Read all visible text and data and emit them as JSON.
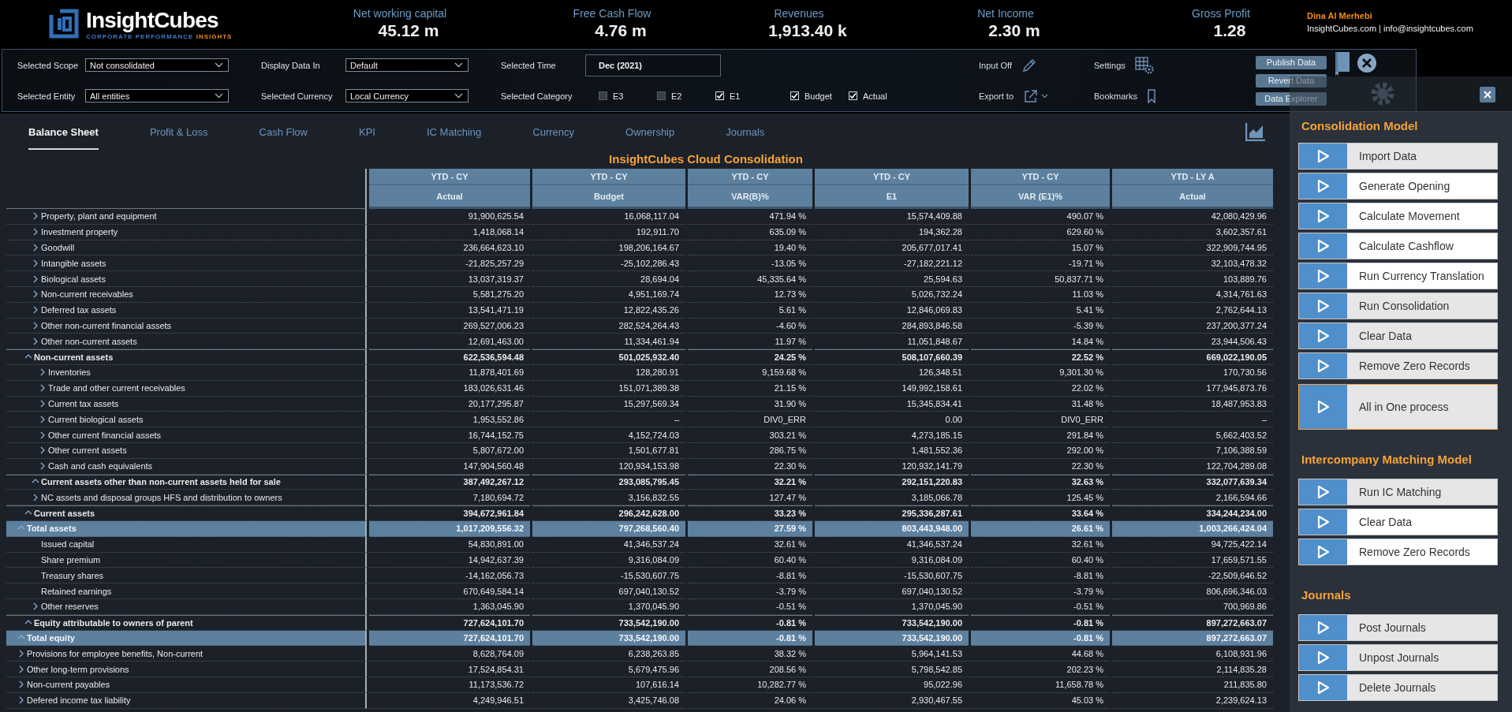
{
  "header": {
    "logo": {
      "wordmark": "InsightCubes",
      "tagline_lead": "CORPORATE PERFORMANCE",
      "tagline_accent": "INSIGHTS"
    },
    "kpis": [
      {
        "label": "Net working capital",
        "value": "45.12 m"
      },
      {
        "label": "Free Cash Flow",
        "value": "4.76 m"
      },
      {
        "label": "Revenues",
        "value": "1,913.40 k"
      },
      {
        "label": "Net Income",
        "value": "2.30 m"
      },
      {
        "label": "Gross Profit",
        "value": "1.28"
      }
    ],
    "user": {
      "name": "Dina Al Merhebi",
      "contact": "InsightCubes.com | info@insightcubes.com"
    }
  },
  "filters": {
    "scope": {
      "label": "Selected Scope",
      "value": "Not consolidated"
    },
    "entity": {
      "label": "Selected Entity",
      "value": "All entities"
    },
    "display": {
      "label": "Display Data In",
      "value": "Default"
    },
    "currency": {
      "label": "Selected Currency",
      "value": "Local Currency"
    },
    "time": {
      "label": "Selected Time",
      "value": "Dec (2021)"
    },
    "category": {
      "label": "Selected Category",
      "options": [
        {
          "label": "E3",
          "checked": false
        },
        {
          "label": "E2",
          "checked": false
        },
        {
          "label": "E1",
          "checked": true
        },
        {
          "label": "Budget",
          "checked": true
        },
        {
          "label": "Actual",
          "checked": true
        }
      ]
    },
    "actions": [
      {
        "label": "Input Off",
        "kind": "edit"
      },
      {
        "label": "Export to",
        "kind": "export"
      },
      {
        "label": "Settings",
        "kind": "settings"
      },
      {
        "label": "Bookmarks",
        "kind": "bookmarks"
      }
    ],
    "data_buttons": [
      "Publish Data",
      "Revert Data",
      "Data Explorer"
    ]
  },
  "tabs": [
    {
      "label": "Balance Sheet",
      "selected": true
    },
    {
      "label": "Profit & Loss",
      "selected": false
    },
    {
      "label": "Cash Flow",
      "selected": false
    },
    {
      "label": "KPI",
      "selected": false
    },
    {
      "label": "IC Matching",
      "selected": false
    },
    {
      "label": "Currency",
      "selected": false
    },
    {
      "label": "Ownership",
      "selected": false
    },
    {
      "label": "Journals",
      "selected": false
    }
  ],
  "report": {
    "title": "InsightCubes Cloud Consolidation",
    "columns": [
      {
        "period": "YTD - CY",
        "measure": "Actual"
      },
      {
        "period": "YTD - CY",
        "measure": "Budget"
      },
      {
        "period": "YTD - CY",
        "measure": "VAR(B)%"
      },
      {
        "period": "YTD - CY",
        "measure": "E1"
      },
      {
        "period": "YTD - CY",
        "measure": "VAR (E1)%"
      },
      {
        "period": "YTD - LY A",
        "measure": "Actual"
      }
    ],
    "rows": [
      {
        "label": "Total assets",
        "expanded": true,
        "kind": "total",
        "values": [
          "1,017,209,556.32",
          "797,268,560.40",
          "27.59 %",
          "803,443,948.00",
          "26.61 %",
          "1,003,266,424.04"
        ],
        "children": [
          {
            "label": "Non-current assets",
            "expanded": true,
            "kind": "subtotal",
            "values": [
              "622,536,594.48",
              "501,025,932.40",
              "24.25 %",
              "508,107,660.39",
              "22.52 %",
              "669,022,190.05"
            ],
            "children": [
              {
                "label": "Property, plant and equipment",
                "expanded": false,
                "kind": "item",
                "values": [
                  "91,900,625.54",
                  "16,068,117.04",
                  "471.94 %",
                  "15,574,409.88",
                  "490.07 %",
                  "42,080,429.96"
                ]
              },
              {
                "label": "Investment property",
                "expanded": false,
                "kind": "item",
                "values": [
                  "1,418,068.14",
                  "192,911.70",
                  "635.09 %",
                  "194,362.28",
                  "629.60 %",
                  "3,602,357.61"
                ]
              },
              {
                "label": "Goodwill",
                "expanded": false,
                "kind": "item",
                "values": [
                  "236,664,623.10",
                  "198,206,164.67",
                  "19.40 %",
                  "205,677,017.41",
                  "15.07 %",
                  "322,909,744.95"
                ]
              },
              {
                "label": "Intangible assets",
                "expanded": false,
                "kind": "item",
                "values": [
                  "-21,825,257.29",
                  "-25,102,286.43",
                  "-13.05 %",
                  "-27,182,221.12",
                  "-19.71 %",
                  "32,103,478.32"
                ]
              },
              {
                "label": "Biological assets",
                "expanded": false,
                "kind": "item",
                "values": [
                  "13,037,319.37",
                  "28,694.04",
                  "45,335.64 %",
                  "25,594.63",
                  "50,837.71 %",
                  "103,889.76"
                ]
              },
              {
                "label": "Non-current receivables",
                "expanded": false,
                "kind": "item",
                "values": [
                  "5,581,275.20",
                  "4,951,169.74",
                  "12.73 %",
                  "5,026,732.24",
                  "11.03 %",
                  "4,314,761.63"
                ]
              },
              {
                "label": "Deferred tax assets",
                "expanded": false,
                "kind": "item",
                "values": [
                  "13,541,471.19",
                  "12,822,435.26",
                  "5.61 %",
                  "12,846,069.83",
                  "5.41 %",
                  "2,762,644.13"
                ]
              },
              {
                "label": "Other non-current financial assets",
                "expanded": false,
                "kind": "item",
                "values": [
                  "269,527,006.23",
                  "282,524,264.43",
                  "-4.60 %",
                  "284,893,846.58",
                  "-5.39 %",
                  "237,200,377.24"
                ]
              },
              {
                "label": "Other non-current assets",
                "expanded": false,
                "kind": "item",
                "values": [
                  "12,691,463.00",
                  "11,334,461.94",
                  "11.97 %",
                  "11,051,848.67",
                  "14.84 %",
                  "23,944,506.43"
                ]
              }
            ]
          },
          {
            "label": "Current assets",
            "expanded": true,
            "kind": "subtotal",
            "values": [
              "394,672,961.84",
              "296,242,628.00",
              "33.23 %",
              "295,336,287.61",
              "33.64 %",
              "334,244,234.00"
            ],
            "children": [
              {
                "label": "Current assets other than non-current assets held for sale",
                "expanded": true,
                "kind": "subtotal",
                "values": [
                  "387,492,267.12",
                  "293,085,795.45",
                  "32.21 %",
                  "292,151,220.83",
                  "32.63 %",
                  "332,077,639.34"
                ],
                "children": [
                  {
                    "label": "Inventories",
                    "expanded": false,
                    "kind": "item",
                    "values": [
                      "11,878,401.69",
                      "128,280.91",
                      "9,159.68 %",
                      "126,348.51",
                      "9,301.30 %",
                      "170,730.56"
                    ]
                  },
                  {
                    "label": "Trade and other current receivables",
                    "expanded": false,
                    "kind": "item",
                    "values": [
                      "183,026,631.46",
                      "151,071,389.38",
                      "21.15 %",
                      "149,992,158.61",
                      "22.02 %",
                      "177,945,873.76"
                    ]
                  },
                  {
                    "label": "Current tax assets",
                    "expanded": false,
                    "kind": "item",
                    "values": [
                      "20,177,295.87",
                      "15,297,569.34",
                      "31.90 %",
                      "15,345,834.41",
                      "31.48 %",
                      "18,487,953.83"
                    ]
                  },
                  {
                    "label": "Current biological assets",
                    "expanded": false,
                    "kind": "item",
                    "values": [
                      "1,953,552.86",
                      "–",
                      "DIV0_ERR",
                      "0.00",
                      "DIV0_ERR",
                      "–"
                    ]
                  },
                  {
                    "label": "Other current financial assets",
                    "expanded": false,
                    "kind": "item",
                    "values": [
                      "16,744,152.75",
                      "4,152,724.03",
                      "303.21 %",
                      "4,273,185.15",
                      "291.84 %",
                      "5,662,403.52"
                    ]
                  },
                  {
                    "label": "Other current assets",
                    "expanded": false,
                    "kind": "item",
                    "values": [
                      "5,807,672.00",
                      "1,501,677.81",
                      "286.75 %",
                      "1,481,552.36",
                      "292.00 %",
                      "7,106,388.59"
                    ]
                  },
                  {
                    "label": "Cash and cash equivalents",
                    "expanded": false,
                    "kind": "item",
                    "values": [
                      "147,904,560.48",
                      "120,934,153.98",
                      "22.30 %",
                      "120,932,141.79",
                      "22.30 %",
                      "122,704,289.08"
                    ]
                  }
                ]
              },
              {
                "label": "NC assets and disposal groups HFS and distribution to owners",
                "expanded": false,
                "kind": "item",
                "values": [
                  "7,180,694.72",
                  "3,156,832.55",
                  "127.47 %",
                  "3,185,066.78",
                  "125.45 %",
                  "2,166,594.66"
                ]
              }
            ]
          }
        ]
      },
      {
        "label": "Total equity",
        "expanded": true,
        "kind": "total",
        "values": [
          "727,624,101.70",
          "733,542,190.00",
          "-0.81 %",
          "733,542,190.00",
          "-0.81 %",
          "897,272,663.07"
        ],
        "children": [
          {
            "label": "Equity attributable to owners of parent",
            "expanded": true,
            "kind": "subtotal",
            "values": [
              "727,624,101.70",
              "733,542,190.00",
              "-0.81 %",
              "733,542,190.00",
              "-0.81 %",
              "897,272,663.07"
            ],
            "children": [
              {
                "label": "Issued capital",
                "kind": "item",
                "values": [
                  "54,830,891.00",
                  "41,346,537.24",
                  "32.61 %",
                  "41,346,537.24",
                  "32.61 %",
                  "94,725,422.14"
                ]
              },
              {
                "label": "Share premium",
                "kind": "item",
                "values": [
                  "14,942,637.39",
                  "9,316,084.09",
                  "60.40 %",
                  "9,316,084.09",
                  "60.40 %",
                  "17,659,571.55"
                ]
              },
              {
                "label": "Treasury shares",
                "kind": "item",
                "values": [
                  "-14,162,056.73",
                  "-15,530,607.75",
                  "-8.81 %",
                  "-15,530,607.75",
                  "-8.81 %",
                  "-22,509,646.52"
                ]
              },
              {
                "label": "Retained earnings",
                "kind": "item",
                "values": [
                  "670,649,584.14",
                  "697,040,130.52",
                  "-3.79 %",
                  "697,040,130.52",
                  "-3.79 %",
                  "806,696,346.03"
                ]
              },
              {
                "label": "Other reserves",
                "expanded": false,
                "kind": "item",
                "values": [
                  "1,363,045.90",
                  "1,370,045.90",
                  "-0.51 %",
                  "1,370,045.90",
                  "-0.51 %",
                  "700,969.86"
                ]
              }
            ]
          }
        ]
      },
      {
        "label": "Provisions for employee benefits, Non-current",
        "expanded": false,
        "kind": "item",
        "values": [
          "8,628,764.09",
          "6,238,263.85",
          "38.32 %",
          "5,964,141.53",
          "44.68 %",
          "6,108,931.96"
        ]
      },
      {
        "label": "Other long-term provisions",
        "expanded": false,
        "kind": "item",
        "values": [
          "17,524,854.31",
          "5,679,475.96",
          "208.56 %",
          "5,798,542.85",
          "202.23 %",
          "2,114,835.28"
        ]
      },
      {
        "label": "Non-current payables",
        "expanded": false,
        "kind": "item",
        "values": [
          "11,173,536.72",
          "107,616.14",
          "10,282.77 %",
          "95,022.96",
          "11,658.78 %",
          "211,835.80"
        ]
      },
      {
        "label": "Defered income tax liability",
        "expanded": false,
        "kind": "item",
        "values": [
          "4,249,946.51",
          "3,425,746.08",
          "24.06 %",
          "2,930,467.55",
          "45.03 %",
          "2,239,624.13"
        ]
      }
    ]
  },
  "panel": {
    "sections": [
      {
        "title": "Consolidation Model",
        "buttons": [
          {
            "label": "Import Data",
            "kind": "normal",
            "highlighted": false
          },
          {
            "label": "Generate Opening",
            "kind": "normal",
            "highlighted": true
          },
          {
            "label": "Calculate Movement",
            "kind": "normal",
            "highlighted": true
          },
          {
            "label": "Calculate Cashflow",
            "kind": "normal",
            "highlighted": true
          },
          {
            "label": "Run Currency Translation",
            "kind": "normal",
            "highlighted": true
          },
          {
            "label": "Run Consolidation",
            "kind": "normal",
            "highlighted": false
          },
          {
            "label": "Clear Data",
            "kind": "normal",
            "highlighted": false
          },
          {
            "label": "Remove Zero Records",
            "kind": "normal",
            "highlighted": false
          },
          {
            "label": "All in One process",
            "kind": "large",
            "highlighted": false
          }
        ]
      },
      {
        "title": "Intercompany Matching Model",
        "buttons": [
          {
            "label": "Run IC Matching",
            "kind": "normal",
            "highlighted": false
          },
          {
            "label": "Clear Data",
            "kind": "normal",
            "highlighted": true
          },
          {
            "label": "Remove Zero Records",
            "kind": "normal",
            "highlighted": true
          }
        ]
      },
      {
        "title": "Journals",
        "buttons": [
          {
            "label": "Post Journals",
            "kind": "normal",
            "highlighted": false
          },
          {
            "label": "Unpost Journals",
            "kind": "normal",
            "highlighted": false
          },
          {
            "label": "Delete Journals",
            "kind": "normal",
            "highlighted": false
          }
        ]
      }
    ]
  }
}
